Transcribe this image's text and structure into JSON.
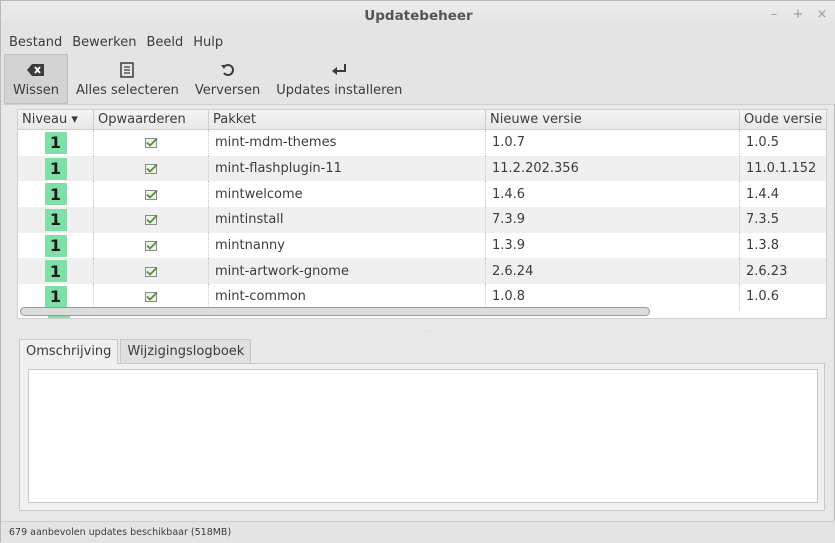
{
  "window": {
    "title": "Updatebeheer",
    "controls": [
      "–",
      "+",
      "×"
    ]
  },
  "menubar": {
    "items": [
      "Bestand",
      "Bewerken",
      "Beeld",
      "Hulp"
    ]
  },
  "toolbar": {
    "buttons": [
      {
        "label": "Wissen",
        "icon": "clear-icon",
        "active": true
      },
      {
        "label": "Alles selecteren",
        "icon": "select-all-icon",
        "active": false
      },
      {
        "label": "Verversen",
        "icon": "refresh-icon",
        "active": false
      },
      {
        "label": "Updates installeren",
        "icon": "install-icon",
        "active": false
      }
    ]
  },
  "table": {
    "headers": [
      "Niveau ▾",
      "Opwaarderen",
      "Pakket",
      "Nieuwe versie",
      "Oude versie"
    ],
    "rows": [
      {
        "level": "1",
        "checked": true,
        "package": "mint-mdm-themes",
        "new": "1.0.7",
        "old": "1.0.5"
      },
      {
        "level": "1",
        "checked": true,
        "package": "mint-flashplugin-11",
        "new": "11.2.202.356",
        "old": "11.0.1.152"
      },
      {
        "level": "1",
        "checked": true,
        "package": "mintwelcome",
        "new": "1.4.6",
        "old": "1.4.4"
      },
      {
        "level": "1",
        "checked": true,
        "package": "mintinstall",
        "new": "7.3.9",
        "old": "7.3.5"
      },
      {
        "level": "1",
        "checked": true,
        "package": "mintnanny",
        "new": "1.3.9",
        "old": "1.3.8"
      },
      {
        "level": "1",
        "checked": true,
        "package": "mint-artwork-gnome",
        "new": "2.6.24",
        "old": "2.6.23"
      },
      {
        "level": "1",
        "checked": true,
        "package": "mint-common",
        "new": "1.0.8",
        "old": "1.0.6"
      }
    ],
    "level_color": "#7ee0a6",
    "check_color": "#5a8a3a"
  },
  "tabs": {
    "items": [
      "Omschrijving",
      "Wijzigingslogboek"
    ],
    "selected": 0
  },
  "statusbar": {
    "text": "679 aanbevolen updates beschikbaar (518MB)"
  }
}
